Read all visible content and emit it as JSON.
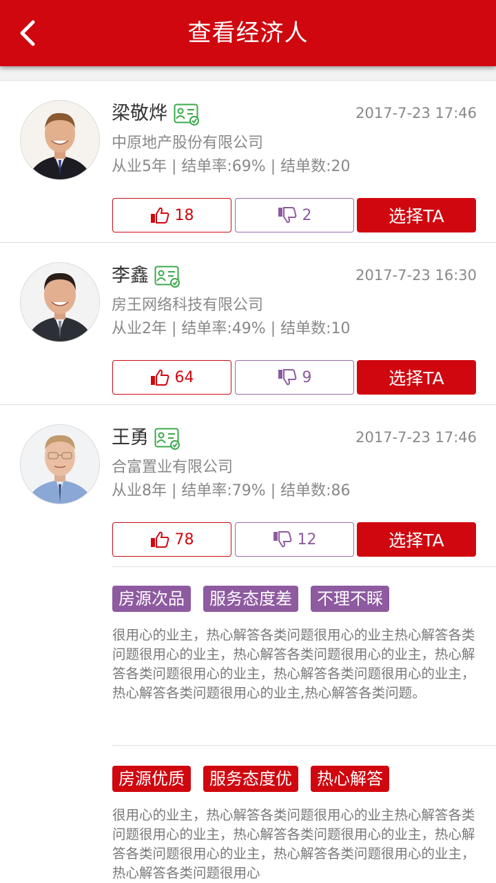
{
  "header": {
    "title": "查看经济人"
  },
  "agents": [
    {
      "name": "梁敬烨",
      "time": "2017-7-23 17:46",
      "company": "中原地产股份有限公司",
      "stats": "从业5年 | 结单率:69% | 结单数:20",
      "likes": "18",
      "dislikes": "2",
      "select_label": "选择TA"
    },
    {
      "name": "李鑫",
      "time": "2017-7-23 16:30",
      "company": "房王网络科技有限公司",
      "stats": "从业2年 | 结单率:49% | 结单数:10",
      "likes": "64",
      "dislikes": "9",
      "select_label": "选择TA"
    },
    {
      "name": "王勇",
      "time": "2017-7-23 17:46",
      "company": "合富置业有限公司",
      "stats": "从业8年 | 结单率:79% | 结单数:86",
      "likes": "78",
      "dislikes": "12",
      "select_label": "选择TA"
    }
  ],
  "reviews": [
    {
      "tags": [
        "房源次品",
        "服务态度差",
        "不理不睬"
      ],
      "tag_type": "negative",
      "text": "很用心的业主，热心解答各类问题很用心的业主热心解答各类问题很用心的业主，热心解答各类问题很用心的业主，热心解答各类问题很用心的业主，热心解答各类问题很用心的业主，热心解答各类问题很用心的业主,热心解答各类问题。"
    },
    {
      "tags": [
        "房源优质",
        "服务态度优",
        "热心解答"
      ],
      "tag_type": "positive",
      "text": "很用心的业主，热心解答各类问题很用心的业主热心解答各类问题很用心的业主，热心解答各类问题很用心的业主，热心解答各类问题很用心的业主，热心解答各类问题很用心的业主，热心解答各类问题很用心"
    }
  ],
  "colors": {
    "brand_red": "#d0070f",
    "purple": "#8e5aa0",
    "cert_green": "#3aa84a"
  },
  "icons": [
    "back-arrow-icon",
    "certified-badge-icon",
    "thumbs-up-icon",
    "thumbs-down-icon"
  ]
}
